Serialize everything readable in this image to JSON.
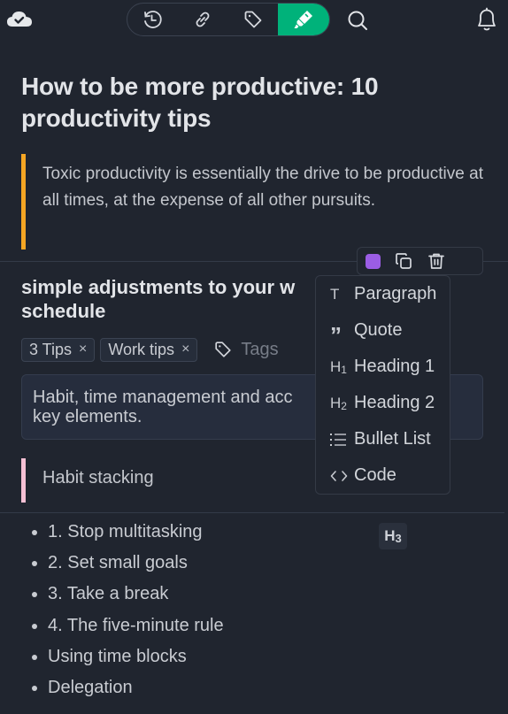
{
  "topbar": {
    "sync_status_icon": "cloud-check-icon",
    "toolbar": [
      {
        "name": "history",
        "icon": "history-icon",
        "active": false
      },
      {
        "name": "link",
        "icon": "link-icon",
        "active": false
      },
      {
        "name": "tag",
        "icon": "tag-icon",
        "active": false
      },
      {
        "name": "highlight",
        "icon": "highlighter-icon",
        "active": true
      }
    ],
    "search_icon": "search-icon",
    "notifications_icon": "bell-icon",
    "accent_color": "#00b27a"
  },
  "document": {
    "title": "How to be more productive: 10 productivity tips",
    "quote": {
      "text": "Toxic productivity is essentially the drive to be productive at all times, at the expense of all other pursuits.",
      "border_color": "#f5a623"
    },
    "section_heading": "simple adjustments to your w… schedule",
    "section_heading_line1": "simple adjustments to your w",
    "section_heading_line2": "schedule",
    "tags": [
      {
        "label": "3 Tips",
        "remove": "×"
      },
      {
        "label": "Work tips",
        "remove": "×"
      }
    ],
    "tags_placeholder": "Tags",
    "callout": {
      "line1": "Habit, time management and acc",
      "line2": "key elements."
    },
    "quote2": {
      "text": "Habit stacking",
      "border_color": "#f5c0d4"
    },
    "list": [
      "1. Stop multitasking",
      "2. Set small goals",
      "3. Take a break",
      "4. The five-minute rule",
      "Using time blocks",
      "Delegation"
    ]
  },
  "block_toolbar": {
    "color_swatch": "#9b5de5",
    "duplicate_icon": "copy-icon",
    "heading_level": {
      "letter": "H",
      "sub": "3"
    },
    "delete_icon": "trash-icon"
  },
  "turn_into_menu": {
    "items": [
      {
        "label": "Paragraph",
        "icon": "T",
        "icon_name": "text-icon"
      },
      {
        "label": "Quote",
        "icon": "”",
        "icon_name": "quote-icon"
      },
      {
        "label": "Heading 1",
        "icon": "H",
        "sub": "1",
        "icon_name": "heading-1-icon"
      },
      {
        "label": "Heading 2",
        "icon": "H",
        "sub": "2",
        "icon_name": "heading-2-icon"
      },
      {
        "label": "Bullet List",
        "icon": "☰",
        "icon_name": "bullet-list-icon"
      },
      {
        "label": "Code",
        "icon": "<>",
        "icon_name": "code-icon"
      }
    ]
  }
}
